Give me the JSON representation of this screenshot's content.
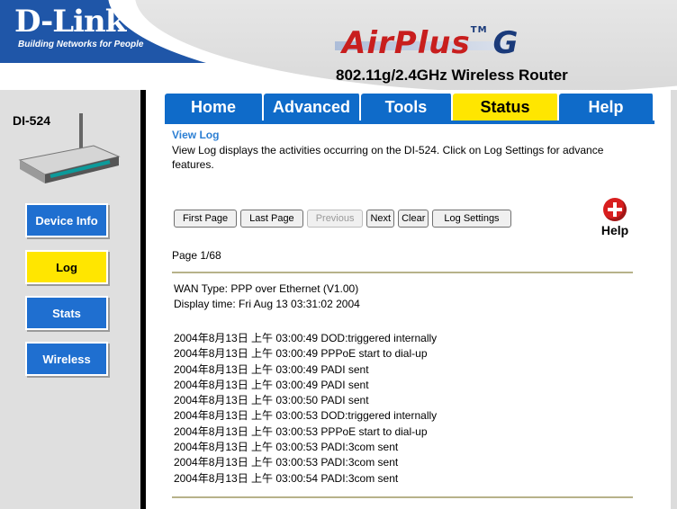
{
  "brand": {
    "logo": "D-Link",
    "tagline": "Building Networks for People",
    "product": "AirPlus",
    "product_suffix": "G",
    "product_tm": "TM"
  },
  "model_title": "802.11g/2.4GHz Wireless Router",
  "device_label": "DI-524",
  "sidebar": {
    "items": [
      {
        "label": "Device Info",
        "active": false
      },
      {
        "label": "Log",
        "active": true
      },
      {
        "label": "Stats",
        "active": false
      },
      {
        "label": "Wireless",
        "active": false
      }
    ]
  },
  "tabs": [
    {
      "label": "Home",
      "active": false
    },
    {
      "label": "Advanced",
      "active": false
    },
    {
      "label": "Tools",
      "active": false
    },
    {
      "label": "Status",
      "active": true
    },
    {
      "label": "Help",
      "active": false
    }
  ],
  "page": {
    "heading": "View Log",
    "description": "View Log displays the activities occurring on the DI-524. Click on Log Settings for advance features.",
    "buttons": {
      "first": "First Page",
      "last": "Last Page",
      "previous": "Previous",
      "next": "Next",
      "clear": "Clear",
      "settings": "Log Settings"
    },
    "help_label": "Help",
    "page_indicator": "Page 1/68",
    "wan_type": "WAN Type: PPP over Ethernet (V1.00)",
    "display_time": "Display time: Fri Aug 13 03:31:02 2004",
    "log_entries": [
      "2004年8月13日 上午 03:00:49 DOD:triggered internally",
      "2004年8月13日 上午 03:00:49 PPPoE start to dial-up",
      "2004年8月13日 上午 03:00:49 PADI sent",
      "2004年8月13日 上午 03:00:49 PADI sent",
      "2004年8月13日 上午 03:00:50 PADI sent",
      "2004年8月13日 上午 03:00:53 DOD:triggered internally",
      "2004年8月13日 上午 03:00:53 PPPoE start to dial-up",
      "2004年8月13日 上午 03:00:53 PADI:3com sent",
      "2004年8月13日 上午 03:00:53 PADI:3com sent",
      "2004年8月13日 上午 03:00:54 PADI:3com sent"
    ]
  },
  "colors": {
    "brand_blue": "#1f56a8",
    "tab_blue": "#0f6bc9",
    "active_yellow": "#ffe600",
    "heading_blue": "#2c7fd3",
    "divider": "#b7b28a"
  }
}
